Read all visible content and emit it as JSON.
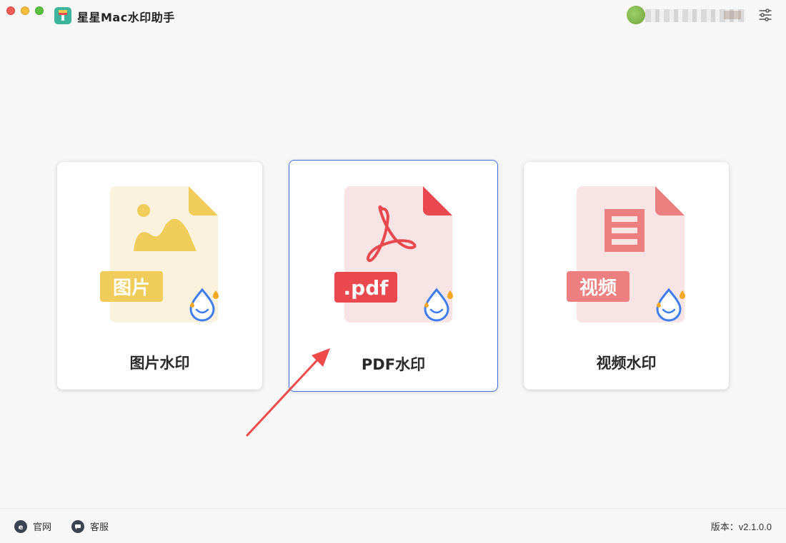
{
  "window": {
    "title": "星星Mac水印助手"
  },
  "cards": [
    {
      "label": "图片水印",
      "badge": "图片"
    },
    {
      "label": "PDF水印",
      "badge": ".pdf"
    },
    {
      "label": "视频水印",
      "badge": "视频"
    }
  ],
  "footer": {
    "website_label": "官网",
    "support_label": "客服",
    "version": "版本：v2.1.0.0"
  },
  "colors": {
    "image_accent": "#f0cd5a",
    "pdf_accent": "#e9494e",
    "video_accent": "#ee7f80",
    "selected_border": "#3b6fe0",
    "drop_blue": "#3e7df0"
  }
}
